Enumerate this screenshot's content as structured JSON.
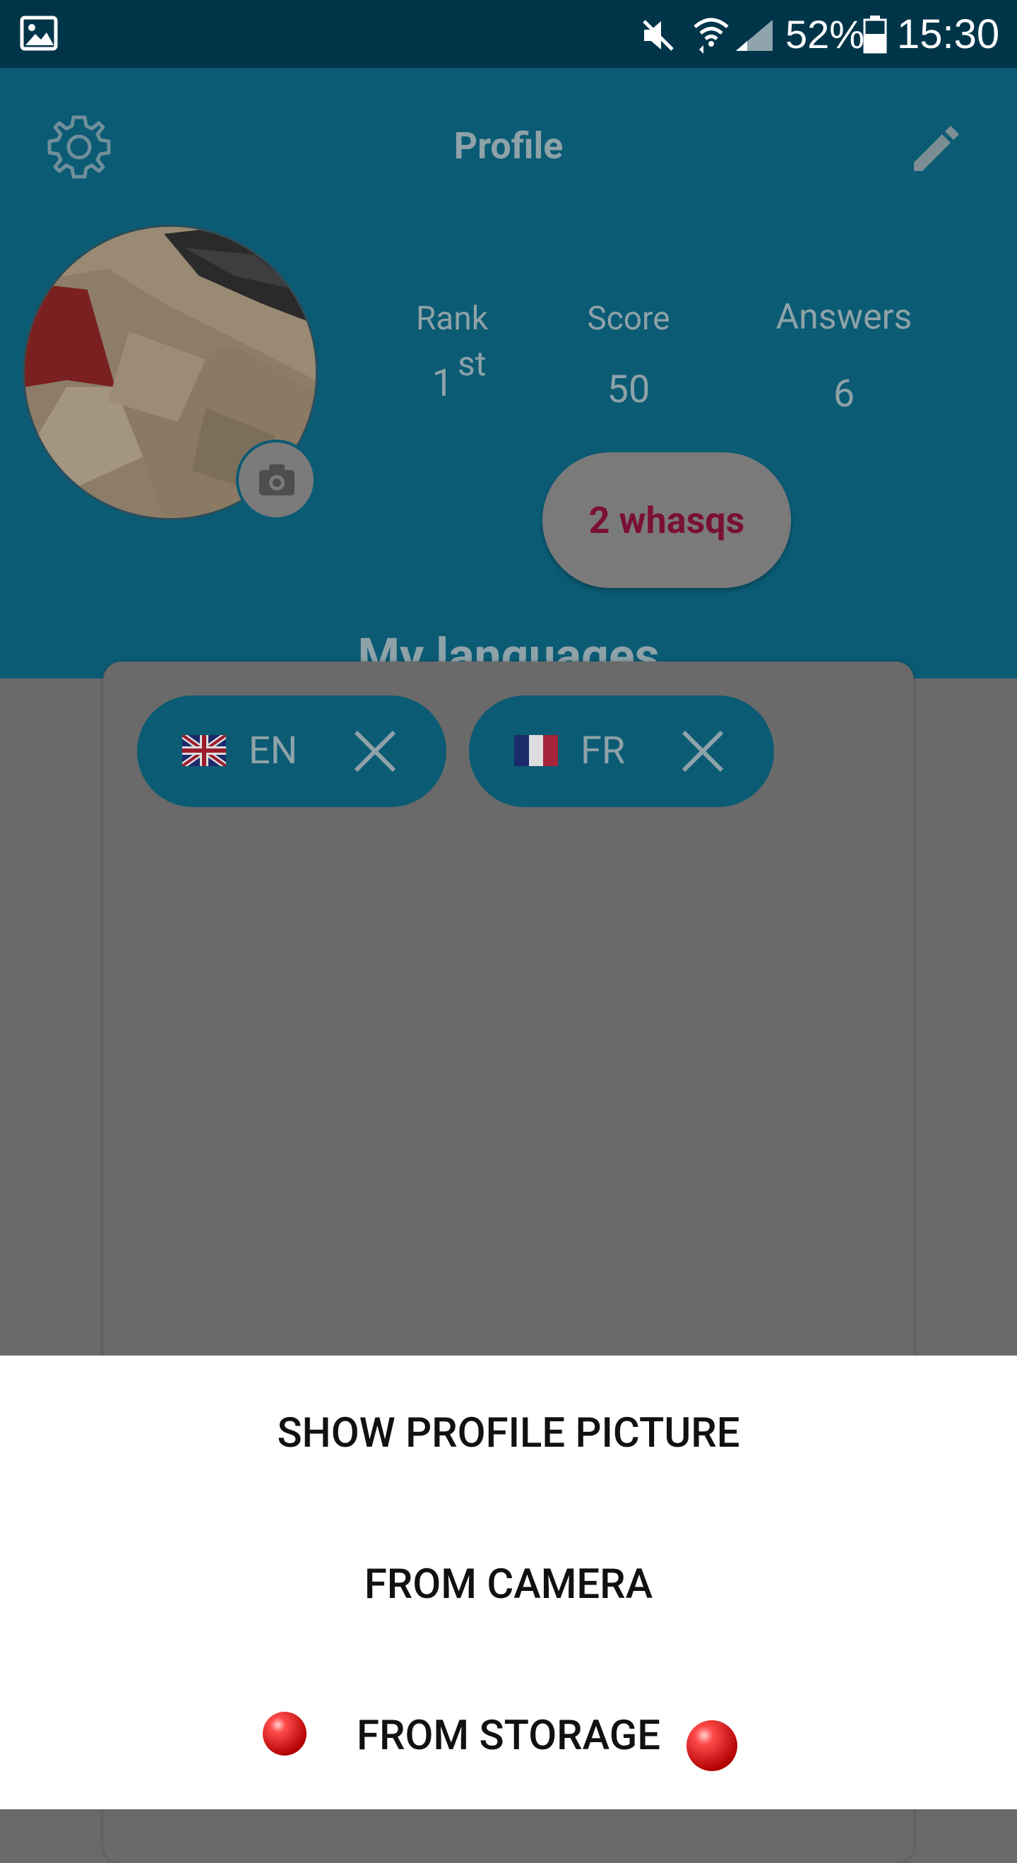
{
  "status_bar": {
    "battery": "52%",
    "time": "15:30",
    "icons": [
      "gallery-icon",
      "mute-icon",
      "wifi-icon",
      "signal-icon",
      "battery-icon"
    ]
  },
  "header": {
    "title": "Profile",
    "settings_icon": "gear-icon",
    "edit_icon": "pencil-icon"
  },
  "profile": {
    "stats": {
      "rank_label": "Rank",
      "rank_value": "1",
      "rank_suffix": "st",
      "score_label": "Score",
      "score_value": "50",
      "answers_label": "Answers",
      "answers_value": "6"
    },
    "whasqs_button": "2 whasqs"
  },
  "languages": {
    "heading": "My languages",
    "chips": [
      {
        "code": "EN",
        "flag": "uk-flag-icon"
      },
      {
        "code": "FR",
        "flag": "france-flag-icon"
      }
    ]
  },
  "bottom_sheet": {
    "items": [
      "SHOW PROFILE PICTURE",
      "FROM CAMERA",
      "FROM STORAGE"
    ]
  },
  "colors": {
    "status_bar_bg": "#003549",
    "header_bg_dimmed": "#0b5b74",
    "accent_text_dimmed": "#8ea2a8",
    "whasqs_text": "#7a1037",
    "sheet_bg": "#ffffff"
  }
}
